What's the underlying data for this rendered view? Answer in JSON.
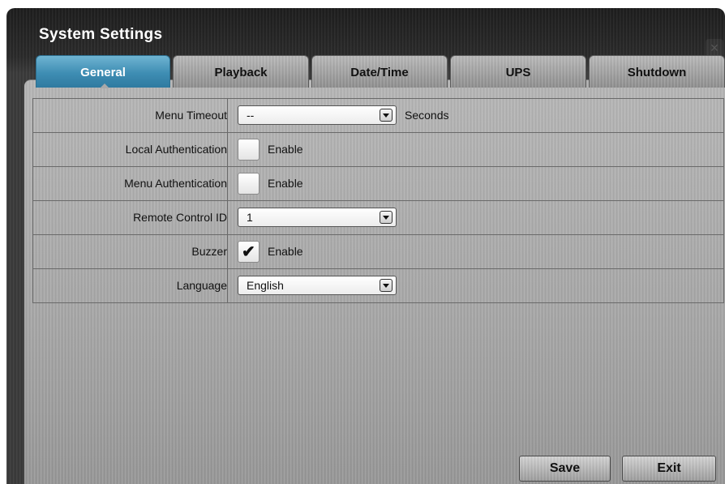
{
  "window": {
    "title": "System Settings"
  },
  "tabs": [
    {
      "label": "General",
      "active": true
    },
    {
      "label": "Playback",
      "active": false
    },
    {
      "label": "Date/Time",
      "active": false
    },
    {
      "label": "UPS",
      "active": false
    },
    {
      "label": "Shutdown",
      "active": false
    }
  ],
  "settings": {
    "menu_timeout": {
      "label": "Menu Timeout",
      "value": "--",
      "unit": "Seconds"
    },
    "local_auth": {
      "label": "Local Authentication",
      "checked": false,
      "option": "Enable"
    },
    "menu_auth": {
      "label": "Menu Authentication",
      "checked": false,
      "option": "Enable"
    },
    "remote_id": {
      "label": "Remote Control ID",
      "value": "1"
    },
    "buzzer": {
      "label": "Buzzer",
      "checked": true,
      "option": "Enable"
    },
    "language": {
      "label": "Language",
      "value": "English"
    }
  },
  "buttons": {
    "save": "Save",
    "exit": "Exit"
  },
  "colors": {
    "active_tab": "#3e8db3",
    "panel": "#a6a6a6",
    "window": "#2a2a2a"
  }
}
